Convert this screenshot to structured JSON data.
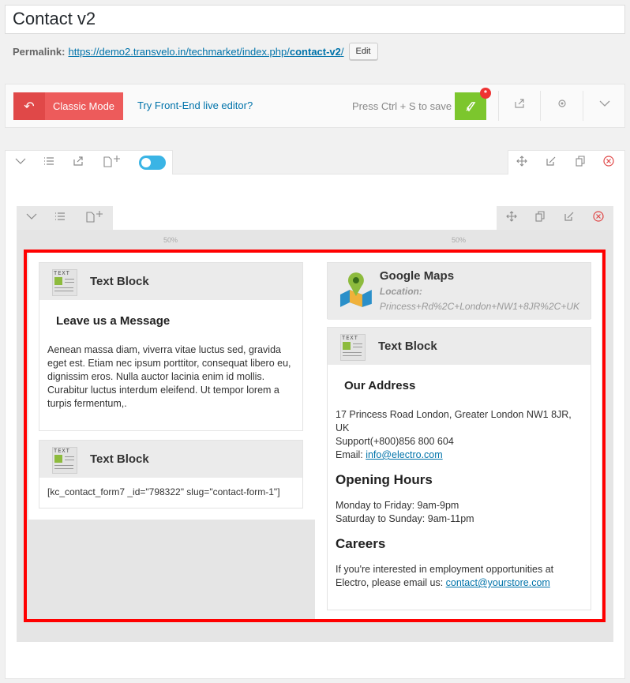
{
  "post_title": "Contact v2",
  "permalink": {
    "label": "Permalink:",
    "url_base": "https://demo2.transvelo.in/techmarket/index.php/",
    "url_slug": "contact-v2",
    "url_trail": "/",
    "edit_label": "Edit"
  },
  "toolbar": {
    "classic_mode": "Classic Mode",
    "frontend_editor": "Try Front-End live editor?",
    "save_hint": "Press Ctrl + S to save",
    "save_badge": "*"
  },
  "columns": {
    "left_width": "50%",
    "right_width": "50%"
  },
  "left": {
    "block1": {
      "title": "Text Block",
      "icon_text": "TEXT",
      "heading": "Leave us a Message",
      "body": "Aenean massa diam, viverra vitae luctus sed, gravida eget est. Etiam nec ipsum porttitor, consequat libero eu, dignissim eros. Nulla auctor lacinia enim id mollis. Curabitur luctus interdum eleifend. Ut tempor lorem a turpis fermentum,."
    },
    "block2": {
      "title": "Text Block",
      "icon_text": "TEXT",
      "shortcode": "[kc_contact_form7 _id=\"798322\" slug=\"contact-form-1\"]"
    }
  },
  "right": {
    "maps": {
      "title": "Google Maps",
      "location_label": "Location:",
      "location_value": "Princess+Rd%2C+London+NW1+8JR%2C+UK"
    },
    "block": {
      "title": "Text Block",
      "icon_text": "TEXT",
      "heading": "Our Address",
      "address_line1": "17 Princess Road London, Greater London NW1 8JR, UK",
      "address_line2": "Support(+800)856 800 604",
      "email_label": "Email: ",
      "email": "info@electro.com",
      "hours_title": "Opening Hours",
      "hours_line1": "Monday to Friday: 9am-9pm",
      "hours_line2": "Saturday to Sunday: 9am-11pm",
      "careers_title": "Careers",
      "careers_text": "If you're interested in employment opportunities at Electro, please email us: ",
      "careers_email": "contact@yourstore.com"
    }
  }
}
